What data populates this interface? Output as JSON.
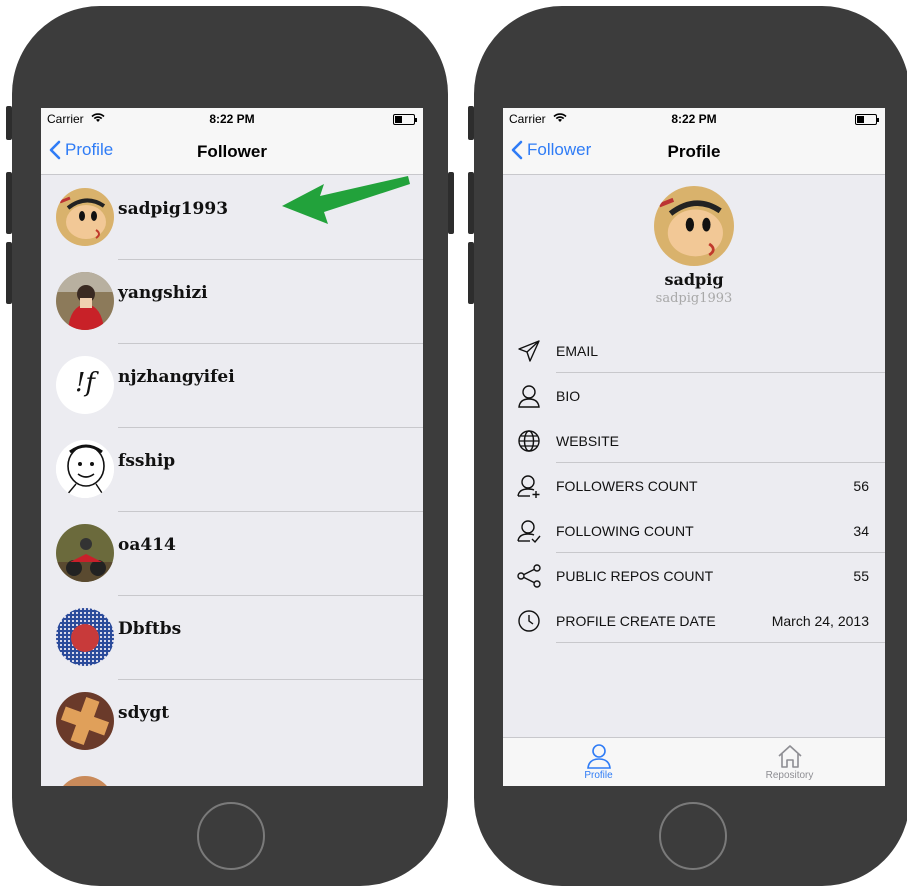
{
  "status_bar": {
    "carrier": "Carrier",
    "time": "8:22 PM"
  },
  "colors": {
    "accent": "#2f7cf6",
    "arrow": "#22a23b",
    "phone_body": "#3c3c3c"
  },
  "left_screen": {
    "nav": {
      "back_label": "Profile",
      "title": "Follower"
    },
    "followers": [
      {
        "name": "sadpig1993",
        "avatar": "cartoon-avatar"
      },
      {
        "name": "yangshizi",
        "avatar": "photo-avatar"
      },
      {
        "name": "njzhangyifei",
        "avatar": "letter-avatar",
        "avatar_text": "!f"
      },
      {
        "name": "fsship",
        "avatar": "meme-face-avatar"
      },
      {
        "name": "oa414",
        "avatar": "motorcycle-avatar"
      },
      {
        "name": "Dbftbs",
        "avatar": "pixel-avatar"
      },
      {
        "name": "sdygt",
        "avatar": "cross-avatar"
      }
    ],
    "annotation": "green-arrow-icon"
  },
  "right_screen": {
    "nav": {
      "back_label": "Follower",
      "title": "Profile"
    },
    "profile": {
      "name": "sadpig",
      "login": "sadpig1993"
    },
    "info_rows": [
      {
        "icon": "send-icon",
        "label": "EMAIL",
        "value": ""
      },
      {
        "icon": "user-icon",
        "label": "BIO",
        "value": ""
      },
      {
        "icon": "globe-icon",
        "label": "WEBSITE",
        "value": ""
      },
      {
        "icon": "user-plus-icon",
        "label": "FOLLOWERS COUNT",
        "value": "56"
      },
      {
        "icon": "user-check-icon",
        "label": "FOLLOWING COUNT",
        "value": "34"
      },
      {
        "icon": "share-icon",
        "label": "PUBLIC REPOS COUNT",
        "value": "55"
      },
      {
        "icon": "clock-icon",
        "label": "PROFILE CREATE DATE",
        "value": "March 24, 2013"
      }
    ],
    "tabs": [
      {
        "label": "Profile",
        "icon": "person-icon",
        "selected": true
      },
      {
        "label": "Repository",
        "icon": "home-icon",
        "selected": false
      }
    ]
  }
}
